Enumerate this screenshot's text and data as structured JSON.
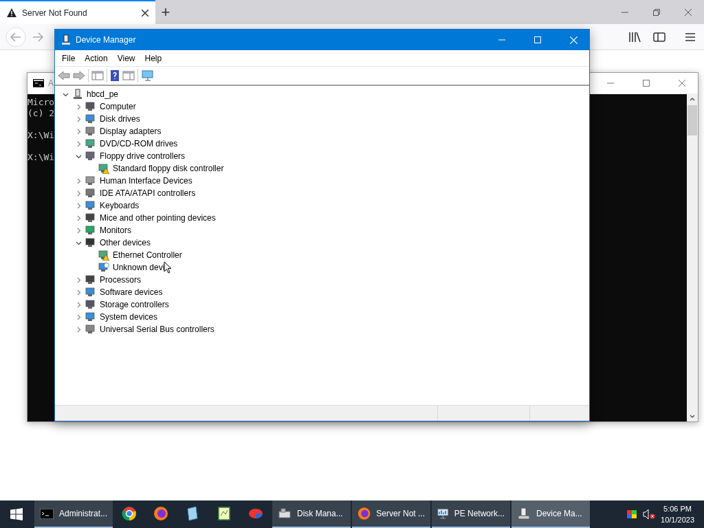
{
  "browser": {
    "tab": {
      "title": "Server Not Found",
      "selected": true
    },
    "new_tab": "+"
  },
  "cmd_window": {
    "title": "A",
    "lines": [
      "Micro",
      "(c) 2",
      "X:\\Wi",
      "X:\\Wi"
    ]
  },
  "device_manager": {
    "title": "Device Manager",
    "menu": [
      "File",
      "Action",
      "View",
      "Help"
    ],
    "tree": [
      {
        "label": "hbcd_pe",
        "expanded": true,
        "children": [
          {
            "label": "Computer",
            "expanded": false
          },
          {
            "label": "Disk drives",
            "expanded": false
          },
          {
            "label": "Display adapters",
            "expanded": false
          },
          {
            "label": "DVD/CD-ROM drives",
            "expanded": false
          },
          {
            "label": "Floppy drive controllers",
            "expanded": true,
            "children": [
              {
                "label": "Standard floppy disk controller",
                "kind": "warning"
              }
            ]
          },
          {
            "label": "Human Interface Devices",
            "expanded": false
          },
          {
            "label": "IDE ATA/ATAPI controllers",
            "expanded": false
          },
          {
            "label": "Keyboards",
            "expanded": false
          },
          {
            "label": "Mice and other pointing devices",
            "expanded": false
          },
          {
            "label": "Monitors",
            "expanded": false
          },
          {
            "label": "Other devices",
            "expanded": true,
            "children": [
              {
                "label": "Ethernet Controller",
                "kind": "warning"
              },
              {
                "label": "Unknown devi",
                "kind": "unknown"
              }
            ]
          },
          {
            "label": "Processors",
            "expanded": false
          },
          {
            "label": "Software devices",
            "expanded": false
          },
          {
            "label": "Storage controllers",
            "expanded": false
          },
          {
            "label": "System devices",
            "expanded": false
          },
          {
            "label": "Universal Serial Bus controllers",
            "expanded": false
          }
        ]
      }
    ]
  },
  "taskbar": {
    "items": [
      {
        "kind": "labeled",
        "label": "Administrat...",
        "selected": false
      },
      {
        "kind": "icon",
        "selected": false
      },
      {
        "kind": "icon",
        "selected": false
      },
      {
        "kind": "icon",
        "selected": false
      },
      {
        "kind": "icon",
        "selected": false
      },
      {
        "kind": "icon",
        "selected": false
      },
      {
        "kind": "labeled",
        "label": "Disk Mana...",
        "selected": false
      },
      {
        "kind": "labeled",
        "label": "Server Not ...",
        "selected": false
      },
      {
        "kind": "labeled",
        "label": "PE Network...",
        "selected": false
      },
      {
        "kind": "labeled",
        "label": "Device Ma...",
        "selected": true
      }
    ],
    "time": "5:06 PM",
    "date": "10/1/2023"
  }
}
